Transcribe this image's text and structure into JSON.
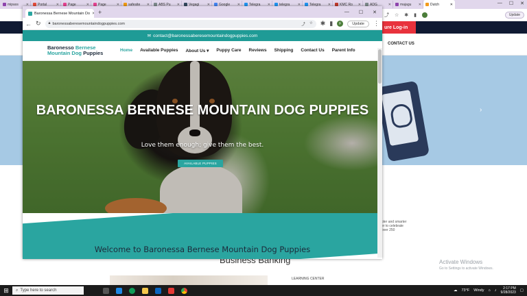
{
  "background_browser": {
    "tabs": [
      "mipass",
      "Portal",
      "Page",
      "Page",
      "safesite",
      "ABS Pu",
      "Vegagi",
      "Google",
      "Telegra",
      "telegra",
      "Telegra",
      "KMC Ro",
      "ADG",
      "majagu"
    ],
    "active_tab": "Dutch",
    "update_label": "Update",
    "login_label": "ure Log-in",
    "contact_us": "CONTACT US",
    "side_heading": "u",
    "side_lines": [
      "pler and smarter",
      "er to celebrate",
      "over 250"
    ],
    "business_banking": "Business Banking",
    "learning_center": "LEARNING CENTER",
    "activate_title": "Activate Windows",
    "activate_sub": "Go to Settings to activate Windows."
  },
  "popup_browser": {
    "tab_title": "Baronessa Bernese Mountain Do",
    "url": "baronessaberesemountaindogpuppies.com",
    "update_label": "Update",
    "avatar_letter": "F"
  },
  "site": {
    "contact_email": "contact@baronessaberesemountaindogpuppies.com",
    "logo_line1_a": "Baronesso",
    "logo_line1_b": "Bernese",
    "logo_line2_a": "Mountain Dog",
    "logo_line2_b": "Puppies",
    "menu": [
      "Home",
      "Available Puppies",
      "About Us ▾",
      "Puppy Care",
      "Reviews",
      "Shipping",
      "Contact Us",
      "Parent Info"
    ],
    "hero_title": "BARONESSA BERNESE MOUNTAIN DOG PUPPIES",
    "hero_subtitle": "Love them enough; give them the best.",
    "hero_button": "AVAILABLE PUPPIES",
    "welcome_heading": "Welcome to Baronessa Bernese Mountain Dog Puppies"
  },
  "taskbar": {
    "search_placeholder": "Type here to search",
    "weather_temp": "73°F",
    "weather_text": "Windy",
    "time": "2:17 PM",
    "date": "9/28/2023"
  },
  "colors": {
    "teal": "#2aa5a0",
    "navy": "#101a33",
    "login_red": "#e8323c",
    "hero_blue": "#a6c9e4"
  }
}
